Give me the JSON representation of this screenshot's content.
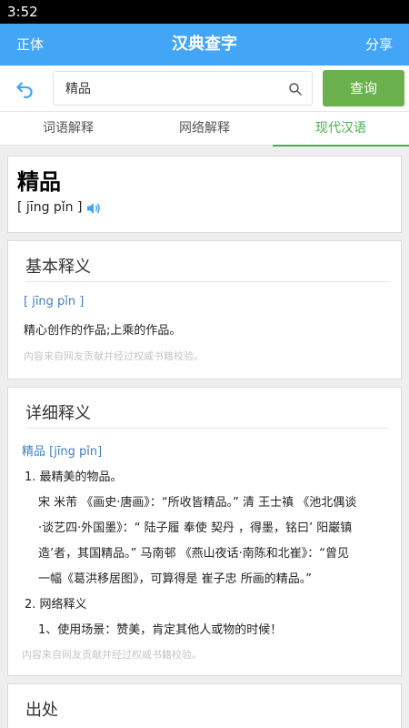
{
  "status_bar": {
    "time": "3:52"
  },
  "app_bar": {
    "left": "正体",
    "title": "汉典查字",
    "right": "分享"
  },
  "search": {
    "value": "精品",
    "button": "查询"
  },
  "tabs": [
    {
      "label": "词语解释",
      "active": false
    },
    {
      "label": "网络解释",
      "active": false
    },
    {
      "label": "现代汉语",
      "active": true
    }
  ],
  "headword": {
    "word": "精品",
    "pinyin": "[ jīng pǐn ]"
  },
  "basic": {
    "title": "基本释义",
    "pinyin": "[ jīng pǐn ]",
    "definition": "精心创作的作品;上乘的作品。",
    "note": "内容来自网友贡献并经过权威书籍校验。"
  },
  "detail": {
    "title": "详细释义",
    "entry": "精品 [jīng pǐn]",
    "item1": "1. 最精美的物品。",
    "item1_lines": [
      "宋 米芾 《画史·唐画》：“所收皆精品。” 清 王士禛 《池北偶谈",
      "·谈艺四·外国墨》：“ 陆子履 奉使 契丹 ，得墨，铭曰’ 阳巌镇",
      "造’者，其国精品。” 马南邨 《燕山夜话·南陈和北崔》：“曾见",
      "一幅《葛洪移居图》，可算得是 崔子忠 所画的精品。”"
    ],
    "item2": "2. 网络释义",
    "item2_line": "1、使用场景：赞美，肯定其他人或物的时候！",
    "note": "内容来自网友贡献并经过权威书籍校验。"
  },
  "source": {
    "title": "出处"
  },
  "colors": {
    "app_bar": "#42a5f5",
    "accent_green": "#4caf50",
    "button_green": "#6ab04c",
    "link_blue": "#3f7fc2"
  }
}
